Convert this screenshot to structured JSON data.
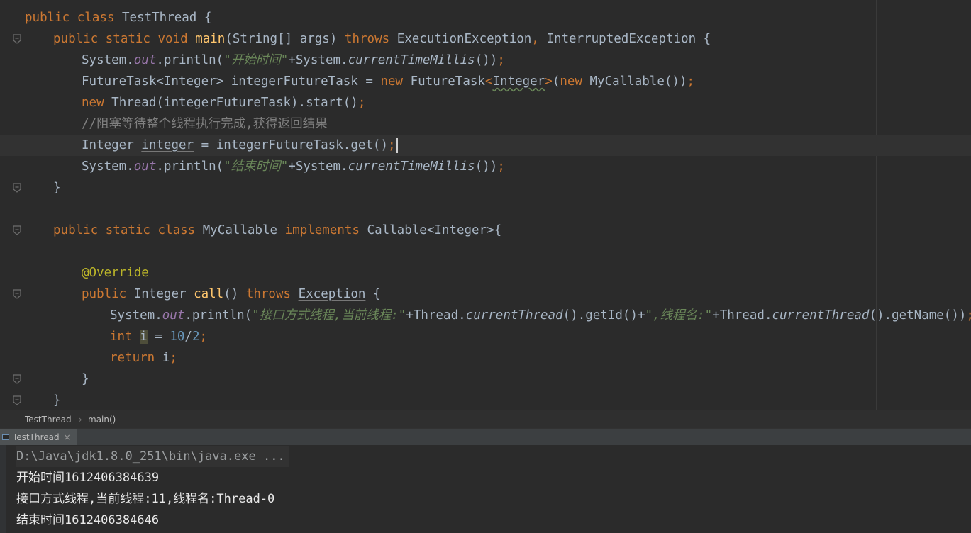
{
  "editor": {
    "lines": [
      {
        "indent": 0,
        "tokens": [
          [
            "kw",
            "public class "
          ],
          [
            "plain",
            "TestThread {"
          ]
        ]
      },
      {
        "indent": 1,
        "fold": true,
        "tokens": [
          [
            "kw",
            "public static void "
          ],
          [
            "fn",
            "main"
          ],
          [
            "plain",
            "(String[] args) "
          ],
          [
            "kw",
            "throws "
          ],
          [
            "plain",
            "ExecutionException"
          ],
          [
            "kw",
            ", "
          ],
          [
            "plain",
            "InterruptedException {"
          ]
        ]
      },
      {
        "indent": 2,
        "tokens": [
          [
            "plain",
            "System."
          ],
          [
            "fld",
            "out"
          ],
          [
            "plain",
            ".println("
          ],
          [
            "str",
            "\"开始时间\""
          ],
          [
            "plain",
            "+System."
          ],
          [
            "sta",
            "currentTimeMillis"
          ],
          [
            "plain",
            "())"
          ],
          [
            "kw",
            ";"
          ]
        ]
      },
      {
        "indent": 2,
        "tokens": [
          [
            "plain",
            "FutureTask<Integer> integerFutureTask = "
          ],
          [
            "kw",
            "new "
          ],
          [
            "plain",
            "FutureTask"
          ],
          [
            "kw",
            "<"
          ],
          [
            "wavy",
            "Integer"
          ],
          [
            "kw",
            ">"
          ],
          [
            "plain",
            "("
          ],
          [
            "kw",
            "new "
          ],
          [
            "plain",
            "MyCallable())"
          ],
          [
            "kw",
            ";"
          ]
        ]
      },
      {
        "indent": 2,
        "tokens": [
          [
            "kw",
            "new "
          ],
          [
            "plain",
            "Thread(integerFutureTask).start()"
          ],
          [
            "kw",
            ";"
          ]
        ]
      },
      {
        "indent": 2,
        "tokens": [
          [
            "cmt",
            "//阻塞等待整个线程执行完成,获得返回结果"
          ]
        ]
      },
      {
        "indent": 2,
        "current": true,
        "caret": true,
        "tokens": [
          [
            "plain",
            "Integer "
          ],
          [
            "ul",
            "integer"
          ],
          [
            "plain",
            " = integerFutureTask.get()"
          ],
          [
            "kw",
            ";"
          ]
        ]
      },
      {
        "indent": 2,
        "tokens": [
          [
            "plain",
            "System."
          ],
          [
            "fld",
            "out"
          ],
          [
            "plain",
            ".println("
          ],
          [
            "str",
            "\"结束时间\""
          ],
          [
            "plain",
            "+System."
          ],
          [
            "sta",
            "currentTimeMillis"
          ],
          [
            "plain",
            "())"
          ],
          [
            "kw",
            ";"
          ]
        ]
      },
      {
        "indent": 1,
        "fold": true,
        "tokens": [
          [
            "plain",
            "}"
          ]
        ]
      },
      {
        "indent": 0,
        "tokens": []
      },
      {
        "indent": 1,
        "fold": true,
        "tokens": [
          [
            "kw",
            "public static class "
          ],
          [
            "plain",
            "MyCallable "
          ],
          [
            "kw",
            "implements "
          ],
          [
            "plain",
            "Callable<Integer>{"
          ]
        ]
      },
      {
        "indent": 0,
        "tokens": []
      },
      {
        "indent": 2,
        "tokens": [
          [
            "ann",
            "@Override"
          ]
        ]
      },
      {
        "indent": 2,
        "fold": true,
        "tokens": [
          [
            "kw",
            "public "
          ],
          [
            "plain",
            "Integer "
          ],
          [
            "fn",
            "call"
          ],
          [
            "plain",
            "() "
          ],
          [
            "kw",
            "throws "
          ],
          [
            "ul",
            "Exception"
          ],
          [
            "plain",
            " {"
          ]
        ]
      },
      {
        "indent": 3,
        "tokens": [
          [
            "plain",
            "System."
          ],
          [
            "fld",
            "out"
          ],
          [
            "plain",
            ".println("
          ],
          [
            "str",
            "\"接口方式线程,当前线程:\""
          ],
          [
            "plain",
            "+Thread."
          ],
          [
            "sta",
            "currentThread"
          ],
          [
            "plain",
            "().getId()+"
          ],
          [
            "str",
            "\",线程名:\""
          ],
          [
            "plain",
            "+Thread."
          ],
          [
            "sta",
            "currentThread"
          ],
          [
            "plain",
            "().getName())"
          ],
          [
            "kw",
            ";"
          ]
        ]
      },
      {
        "indent": 3,
        "tokens": [
          [
            "kw",
            "int "
          ],
          [
            "hl",
            "i"
          ],
          [
            "plain",
            " = "
          ],
          [
            "num",
            "10"
          ],
          [
            "plain",
            "/"
          ],
          [
            "num",
            "2"
          ],
          [
            "kw",
            ";"
          ]
        ]
      },
      {
        "indent": 3,
        "tokens": [
          [
            "kw",
            "return "
          ],
          [
            "plain",
            "i"
          ],
          [
            "kw",
            ";"
          ]
        ]
      },
      {
        "indent": 2,
        "fold": true,
        "tokens": [
          [
            "plain",
            "}"
          ]
        ]
      },
      {
        "indent": 1,
        "fold": true,
        "tokens": [
          [
            "plain",
            "}"
          ]
        ]
      }
    ]
  },
  "breadcrumb": {
    "class_name": "TestThread",
    "separator": "›",
    "method_name": "main()"
  },
  "run_panel": {
    "tab_label": "TestThread",
    "close_label": "×",
    "output": [
      "D:\\Java\\jdk1.8.0_251\\bin\\java.exe ...",
      "开始时间1612406384639",
      "接口方式线程,当前线程:11,线程名:Thread-0",
      "结束时间1612406384646"
    ]
  },
  "colors": {
    "background": "#2b2b2b",
    "keyword": "#cc7832",
    "string": "#6a8759",
    "field": "#9876aa",
    "number": "#6897bb",
    "annotation": "#bbb529",
    "method": "#ffc66d"
  },
  "icons": {
    "fold_marker": "fold-icon",
    "run_tab_icon": "run-config-icon"
  }
}
